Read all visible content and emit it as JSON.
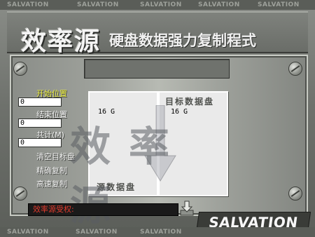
{
  "strip_word": "SALVATION",
  "banner": {
    "logo": "效率源",
    "subtitle": "硬盘数据强力复制程式"
  },
  "labels": {
    "start_pos": "开始位置",
    "end_pos": "结束位置",
    "total": "共计(M)",
    "clear_target": "清空目标盘",
    "precise_copy": "精确复制",
    "fast_copy": "高速复制"
  },
  "fields": {
    "start_value": "0",
    "end_value": "0",
    "total_value": "0"
  },
  "source_disk": {
    "caption": "源数据盘",
    "size": "16  G"
  },
  "target_disk": {
    "caption": "目标数据盘",
    "size": "16  G"
  },
  "watermark": "效率源",
  "copyright": "效率源受权:",
  "brand": "SALVATION",
  "colors": {
    "label_yellow": "#e6e83d",
    "copyright_red": "#e23b2d"
  }
}
